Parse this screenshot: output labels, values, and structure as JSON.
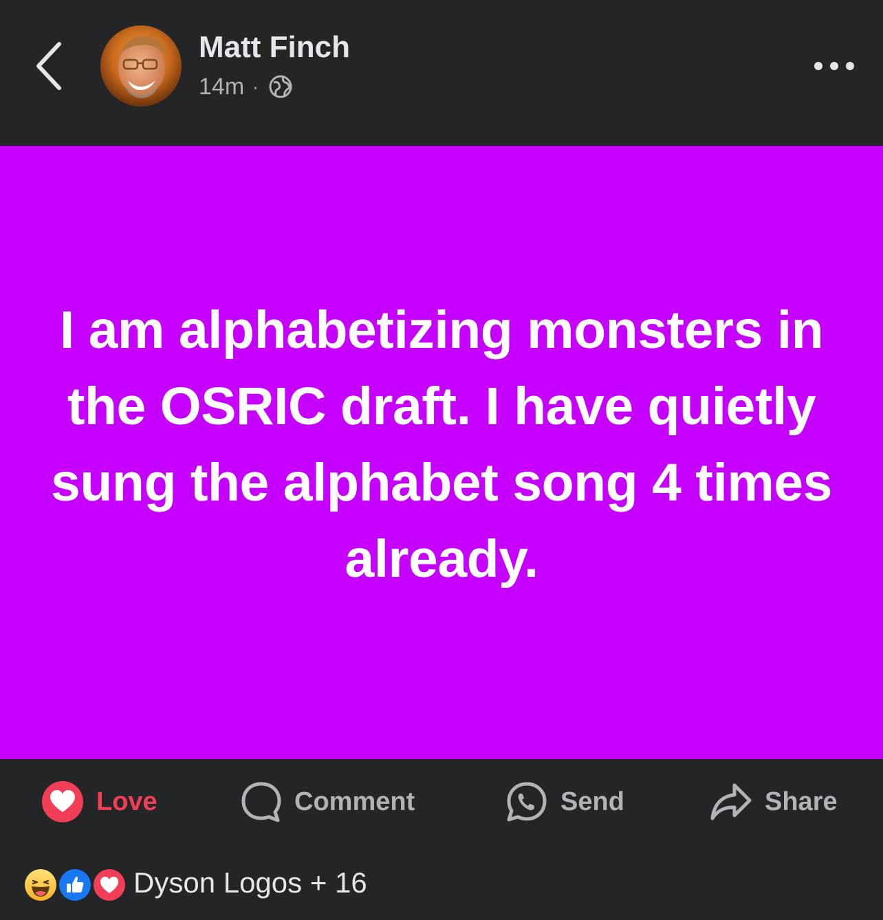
{
  "header": {
    "author_name": "Matt Finch",
    "timestamp": "14m",
    "separator": "·",
    "privacy_icon": "globe-icon",
    "back_icon": "chevron-left-icon",
    "more_icon": "more-horizontal-icon"
  },
  "post": {
    "text": "I am alphabetizing monsters in the OSRIC draft. I have quietly sung the alphabet song 4 times already.",
    "background_color": "#c600ff",
    "text_color": "#ffffff"
  },
  "actions": {
    "love_label": "Love",
    "comment_label": "Comment",
    "send_label": "Send",
    "share_label": "Share",
    "love_color": "#f33e58"
  },
  "reactions": {
    "icons": [
      "haha-icon",
      "like-icon",
      "love-icon"
    ],
    "summary": "Dyson Logos + 16"
  },
  "colors": {
    "background": "#242526",
    "primary_text": "#e4e6eb",
    "secondary_text": "#b0b3b8",
    "like_blue": "#1877f2",
    "love_red": "#f33e58"
  }
}
